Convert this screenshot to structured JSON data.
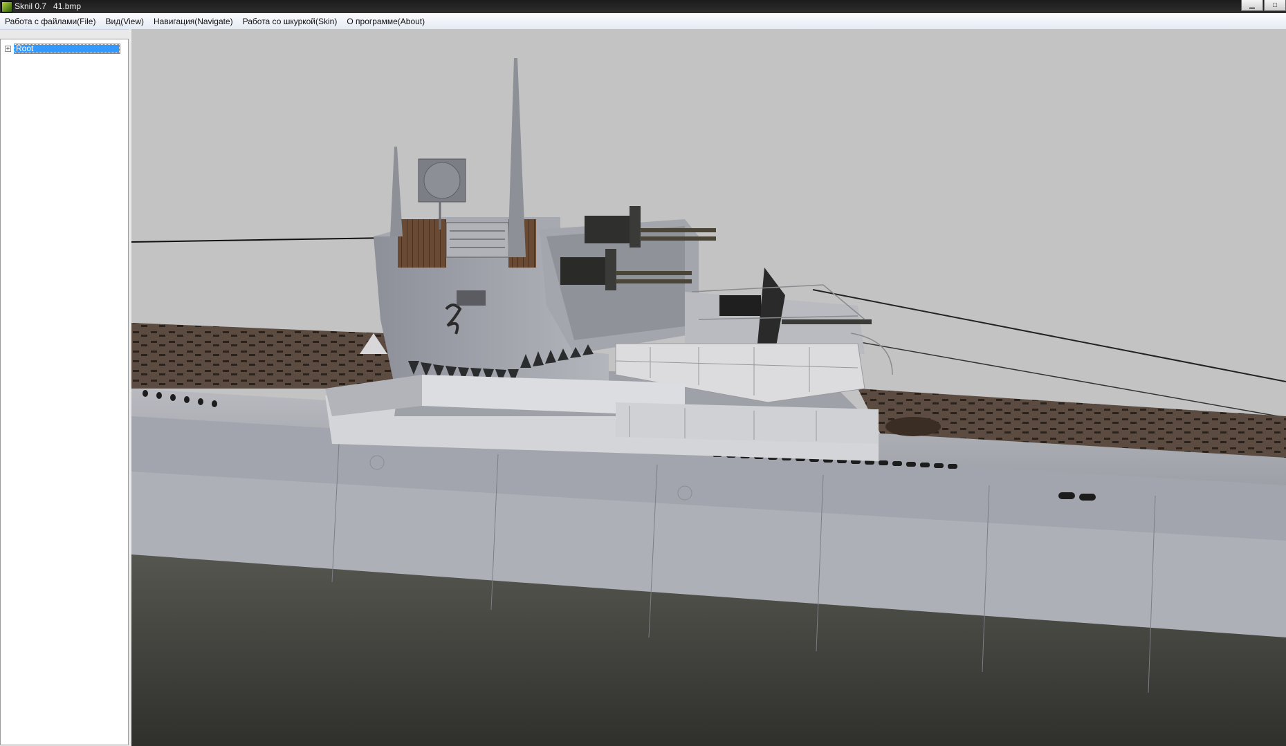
{
  "window": {
    "title": "Sknil 0.7   41.bmp",
    "controls": [
      {
        "name": "minimize-button",
        "glyph": "▁"
      },
      {
        "name": "maximize-button",
        "glyph": "□"
      }
    ]
  },
  "menu": {
    "items": [
      "Работа с файлами(File)",
      "Вид(View)",
      "Навигация(Navigate)",
      "Работа со шкуркой(Skin)",
      "О программе(About)"
    ]
  },
  "tree": {
    "root": {
      "label": "Root",
      "expander": "+"
    }
  },
  "viewport": {
    "background": "#c3c3c3",
    "content": "submarine-3d-model"
  },
  "colors": {
    "titlebar": "#1b1b1b",
    "selection": "#3399ff",
    "hull_light": "#a9acb4",
    "hull_dark": "#3f403c",
    "deck": "#5a4a3f"
  }
}
